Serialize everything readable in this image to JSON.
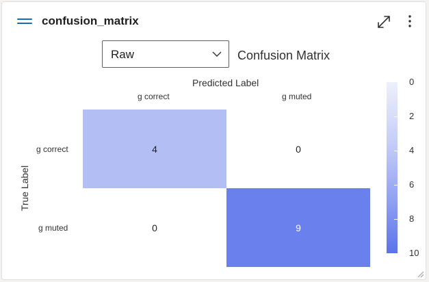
{
  "card": {
    "title": "confusion_matrix"
  },
  "icons": {
    "drag": "drag-handle-icon",
    "expand": "expand-icon",
    "more": "more-vertical-icon",
    "chevron": "chevron-down-icon"
  },
  "controls": {
    "view_select": {
      "selected": "Raw"
    }
  },
  "colors": {
    "accent": "#0f6cbd",
    "low": "#eef0fc",
    "high": "#5b73eb"
  },
  "chart_data": {
    "type": "heatmap",
    "title": "Confusion Matrix",
    "xlabel": "Predicted Label",
    "ylabel": "True Label",
    "x_categories": [
      "g correct",
      "g muted"
    ],
    "y_categories": [
      "g correct",
      "g muted"
    ],
    "values": [
      [
        4,
        0
      ],
      [
        0,
        9
      ]
    ],
    "colorbar": {
      "min": 0,
      "max": 10,
      "ticks": [
        "0",
        "2",
        "4",
        "6",
        "8",
        "10"
      ],
      "reversed": true,
      "placement": "right"
    },
    "grid": false
  }
}
